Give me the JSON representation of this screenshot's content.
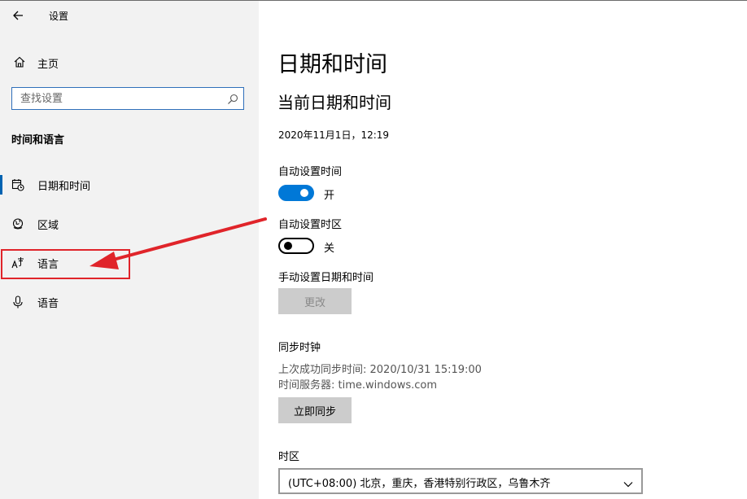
{
  "app": {
    "title": "设置"
  },
  "sidebar": {
    "home_label": "主页",
    "search_placeholder": "查找设置",
    "section_title": "时间和语言",
    "items": [
      {
        "label": "日期和时间",
        "icon": "calendar-clock-icon",
        "active": true
      },
      {
        "label": "区域",
        "icon": "globe-icon",
        "active": false
      },
      {
        "label": "语言",
        "icon": "language-icon",
        "active": false
      },
      {
        "label": "语音",
        "icon": "microphone-icon",
        "active": false
      }
    ]
  },
  "main": {
    "title": "日期和时间",
    "subtitle": "当前日期和时间",
    "current_datetime": "2020年11月1日，12:19",
    "auto_time": {
      "label": "自动设置时间",
      "state": "开",
      "on": true
    },
    "auto_timezone": {
      "label": "自动设置时区",
      "state": "关",
      "on": false
    },
    "manual": {
      "label": "手动设置日期和时间",
      "button": "更改"
    },
    "sync": {
      "label": "同步时钟",
      "last_sync": "上次成功同步时间: 2020/10/31 15:19:00",
      "server": "时间服务器: time.windows.com",
      "button": "立即同步"
    },
    "timezone": {
      "label": "时区",
      "selected": "(UTC+08:00) 北京，重庆，香港特别行政区，乌鲁木齐"
    }
  },
  "colors": {
    "accent": "#0078d7",
    "annotation": "#e0242a",
    "sidebar_bg": "#f2f2f2"
  }
}
